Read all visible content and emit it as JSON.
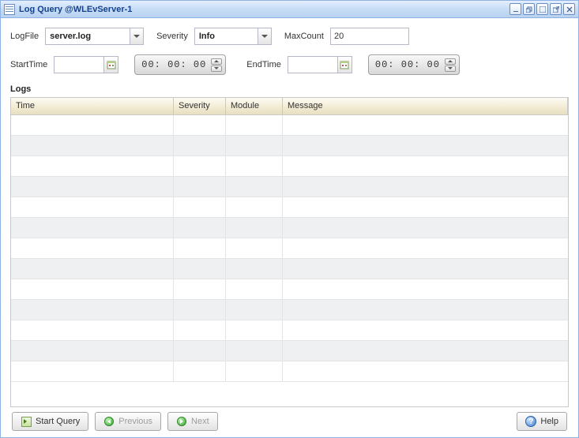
{
  "window": {
    "title": "Log Query @WLEvServer-1"
  },
  "filters": {
    "logfile_label": "LogFile",
    "logfile_value": "server.log",
    "severity_label": "Severity",
    "severity_value": "Info",
    "maxcount_label": "MaxCount",
    "maxcount_value": "20",
    "starttime_label": "StartTime",
    "starttime_date": "",
    "starttime_time": "00: 00: 00",
    "endtime_label": "EndTime",
    "endtime_date": "",
    "endtime_time": "00: 00: 00"
  },
  "grid": {
    "section_label": "Logs",
    "columns": {
      "time": "Time",
      "severity": "Severity",
      "module": "Module",
      "message": "Message"
    },
    "row_count": 13
  },
  "footer": {
    "start_query": "Start Query",
    "previous": "Previous",
    "next": "Next",
    "help": "Help"
  }
}
